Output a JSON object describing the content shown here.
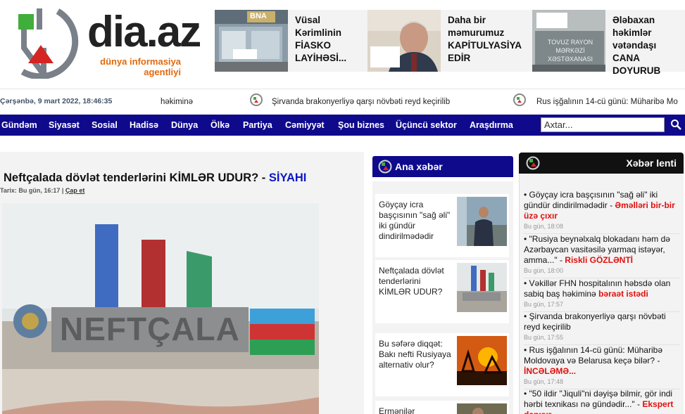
{
  "brand": {
    "name": "dia.az",
    "tagline_line1": "dünya informasiya",
    "tagline_line2": "agentliyi"
  },
  "promos": [
    {
      "text_lines": [
        "Vüsal",
        "Kərimlinin",
        "FİASKO",
        "LAYİHƏSİ..."
      ],
      "image_sign": "BNA"
    },
    {
      "text_lines": [
        "Daha bir",
        "məmurumuz",
        "KAPİTULYASİYA",
        "EDİR"
      ],
      "image_sign": ""
    },
    {
      "text_lines": [
        "Ələbaxan",
        "həkimlər",
        "vətəndaşı",
        "CANA",
        "DOYURUB"
      ],
      "image_sign": "TOVUZ RAYON MƏRKƏZİ XƏSTƏXANASI"
    }
  ],
  "ticker": {
    "date": "Çərşənbə, 9 mart 2022, 18:46:35",
    "items": [
      "həkiminə",
      "Şirvanda brakonyerliyə qarşı növbəti reyd keçirilib",
      "Rus işğalının 14-cü günü: Müharibə Mo"
    ]
  },
  "nav": {
    "items": [
      "Gündəm",
      "Siyasət",
      "Sosial",
      "Hadisə",
      "Dünya",
      "Ölkə",
      "Partiya",
      "Cəmiyyət",
      "Şou biznes",
      "Üçüncü sektor",
      "Araşdırma"
    ],
    "search_placeholder": "Axtar..."
  },
  "main_article": {
    "title": "Neftçalada dövlət tenderlərini KİMLƏR UDUR?",
    "separator": " - ",
    "category": "SİYAHI",
    "meta_prefix": "Tarix: Bu gün, 16:17 | ",
    "print_label": "Çap et",
    "image_sign": "NEFTÇALA"
  },
  "middle": {
    "heading": "Ana xəbər",
    "cards": [
      {
        "text": "Göyçay icra başçısının \"sağ əli\" iki gündür dindirilmədədir"
      },
      {
        "text": "Neftçalada dövlət tenderlərini KİMLƏR UDUR?"
      },
      {
        "text": "Bu səfərə diqqət: Bakı nefti Rusiyaya alternativ olur?"
      },
      {
        "text": "Ermənilər"
      }
    ]
  },
  "right": {
    "heading": "Xəbər lenti",
    "items": [
      {
        "text": "Göyçay icra başçısının \"sağ əli\" iki gündür dindirilmədədir",
        "highlight": "Əməlləri bir-bir üzə çıxır",
        "time": "Bu gün, 18:08"
      },
      {
        "text": "\"Rusiya beynəlxalq blokadanı həm də Azərbaycan vasitəsilə yarmaq istəyər, amma...\"",
        "highlight": "Riskli GÖZLƏNTİ",
        "time": "Bu gün, 18:00"
      },
      {
        "text": "Vəkillər FHN hospitalının həbsdə olan sabiq baş həkiminə",
        "highlight": "bəraət istədi",
        "time": "Bu gün, 17:57"
      },
      {
        "text": "Şirvanda brakonyerliyə qarşı növbəti reyd keçirilib",
        "highlight": "",
        "time": "Bu gün, 17:55"
      },
      {
        "text": "Rus işğalının 14-cü günü: Müharibə Moldovaya və Belarusa keçə bilər?",
        "highlight": "İNCƏLƏMƏ...",
        "time": "Bu gün, 17:48"
      },
      {
        "text": "\"50 ildir \"Jiquli\"ni dəyişə bilmir, gör indi hərbi texnikası nə gündədir...\"",
        "highlight": "Ekspert danışır",
        "time": ""
      }
    ]
  },
  "colors": {
    "nav_bg": "#0f0a8c",
    "brand_orange": "#e2690c",
    "category_blue": "#0a18c8",
    "highlight_red": "#e0100e"
  }
}
